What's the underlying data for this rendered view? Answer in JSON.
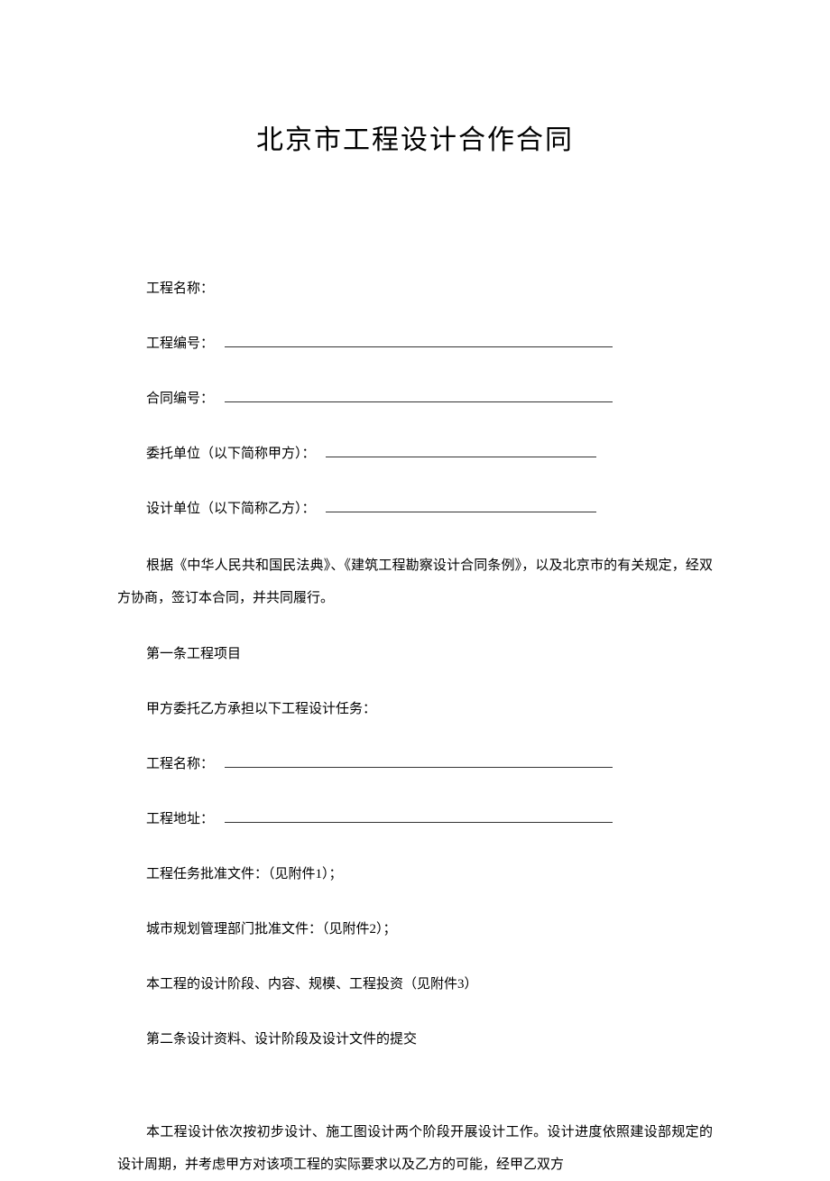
{
  "title": "北京市工程设计合作合同",
  "fields": {
    "project_name_label": "工程名称：",
    "project_no_label": "工程编号：",
    "contract_no_label": "合同编号：",
    "party_a_label": "委托单位（以下简称甲方）：",
    "party_b_label": "设计单位（以下简称乙方）："
  },
  "intro": "根据《中华人民共和国民法典》、《建筑工程勘察设计合同条例》，以及北京市的有关规定，经双方协商，签订本合同，并共同履行。",
  "article1": {
    "heading": "第一条工程项目",
    "intro": "甲方委托乙方承担以下工程设计任务：",
    "project_name_label": "工程名称：",
    "project_addr_label": "工程地址：",
    "approval1": "工程任务批准文件：（见附件1）；",
    "approval2": "城市规划管理部门批准文件：（见附件2）；",
    "approval3": "本工程的设计阶段、内容、规模、工程投资（见附件3）"
  },
  "article2": {
    "heading": "第二条设计资料、设计阶段及设计文件的提交",
    "body": "本工程设计依次按初步设计、施工图设计两个阶段开展设计工作。设计进度依照建设部规定的设计周期，并考虑甲方对该项工程的实际要求以及乙方的可能，经甲乙双方"
  }
}
